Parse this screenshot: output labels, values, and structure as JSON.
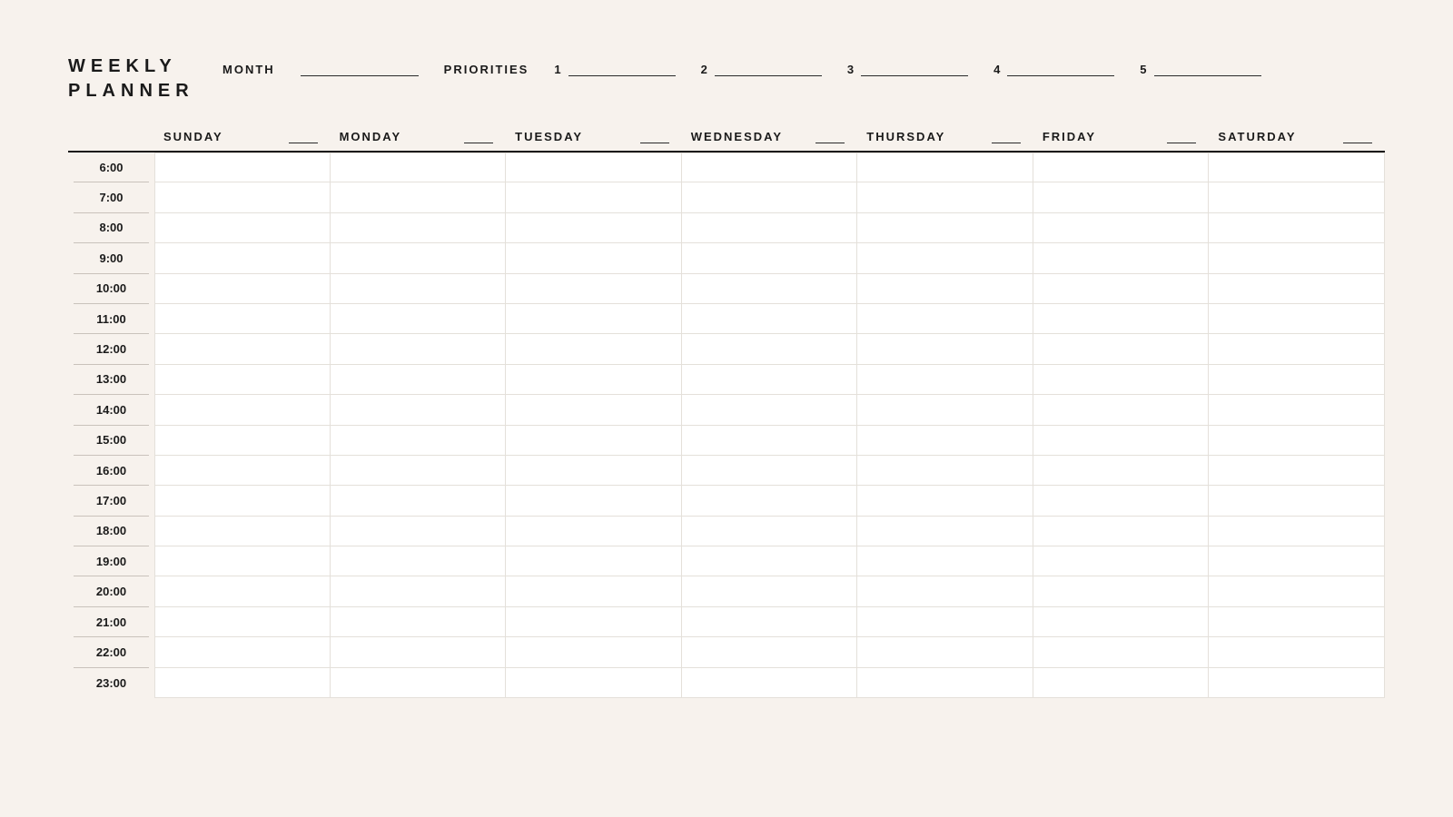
{
  "title": "WEEKLY\nPLANNER",
  "month_label": "MONTH",
  "priorities_label": "PRIORITIES",
  "priorities": [
    "1",
    "2",
    "3",
    "4",
    "5"
  ],
  "days": [
    "SUNDAY",
    "MONDAY",
    "TUESDAY",
    "WEDNESDAY",
    "THURSDAY",
    "FRIDAY",
    "SATURDAY"
  ],
  "hours": [
    "6:00",
    "7:00",
    "8:00",
    "9:00",
    "10:00",
    "11:00",
    "12:00",
    "13:00",
    "14:00",
    "15:00",
    "16:00",
    "17:00",
    "18:00",
    "19:00",
    "20:00",
    "21:00",
    "22:00",
    "23:00"
  ]
}
